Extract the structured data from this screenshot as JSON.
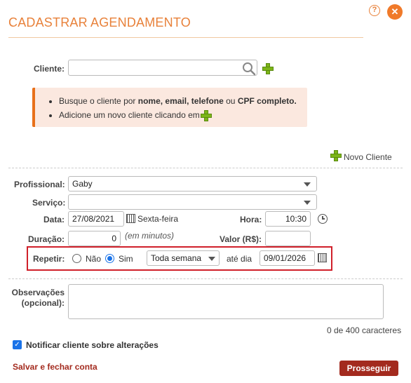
{
  "header": {
    "title": "CADASTRAR AGENDAMENTO",
    "help_glyph": "?",
    "close_glyph": "✕"
  },
  "client": {
    "label": "Cliente:",
    "value": "",
    "placeholder": ""
  },
  "info": {
    "line1_prefix": "Busque o cliente por ",
    "line1_bold1": "nome, email, telefone",
    "line1_mid": " ou ",
    "line1_bold2": "CPF completo.",
    "line2": "Adicione um novo cliente clicando em"
  },
  "new_client_label": "Novo Cliente",
  "form": {
    "profissional_label": "Profissional:",
    "profissional_value": "Gaby",
    "servico_label": "Serviço:",
    "servico_value": "",
    "data_label": "Data:",
    "data_value": "27/08/2021",
    "weekday": "Sexta-feira",
    "hora_label": "Hora:",
    "hora_value": "10:30",
    "duracao_label": "Duração:",
    "duracao_value": "0",
    "duracao_hint": "(em minutos)",
    "valor_label": "Valor (R$):",
    "valor_value": ""
  },
  "repeat": {
    "label": "Repetir:",
    "no_label": "Não",
    "yes_label": "Sim",
    "selected": "Sim",
    "frequency": "Toda semana",
    "until_label": "até dia",
    "until_value": "09/01/2026"
  },
  "observacoes": {
    "label_line1": "Observações",
    "label_line2": "(opcional):",
    "value": "",
    "counter": "0 de 400 caracteres"
  },
  "notify": {
    "label": "Notificar cliente sobre alterações",
    "checked": true
  },
  "footer": {
    "save_close": "Salvar e fechar conta",
    "proceed": "Prosseguir"
  },
  "colors": {
    "accent": "#e8813a",
    "button": "#a32a1e",
    "highlight": "#d0202a",
    "add": "#7cb518"
  }
}
